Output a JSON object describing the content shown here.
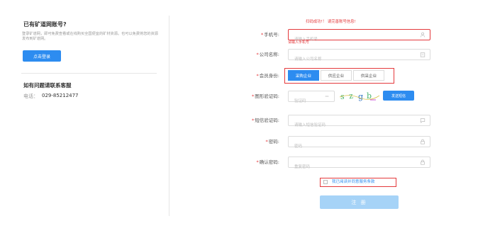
{
  "left": {
    "title": "已有矿道网账号?",
    "description": "登录矿道网，即可免费查看或在线购买全国便宜的矿材资源。也可以免费将您的资源发布到矿道网。",
    "login_label": "点击登录",
    "contact_title": "如有问题请联系客服",
    "phone_label": "电话：",
    "phone_value": "029-85212477"
  },
  "banner": "扫码成功!！ 请完善账号信息!",
  "form": {
    "phone": {
      "label": "手机号:",
      "placeholder": "请输入手机号",
      "icon": "user-icon",
      "error": "请输入手机号"
    },
    "company": {
      "label": "公司名称:",
      "placeholder": "请输入公司名称",
      "icon": "building-icon"
    },
    "role": {
      "label": "会员身份:",
      "options": [
        "采购企业",
        "供应企业",
        "供采企业"
      ],
      "selected": "采购企业"
    },
    "captcha": {
      "label": "图形验证码:",
      "placeholder": "验证码",
      "code": "s z g b",
      "refresh_label": "发送短信"
    },
    "sms": {
      "label": "短信验证码:",
      "placeholder": "请输入短信验证码",
      "icon": "message-icon"
    },
    "password": {
      "label": "密码:",
      "placeholder": "密码",
      "icon": "lock-icon"
    },
    "confirm": {
      "label": "确认密码:",
      "placeholder": "重复密码",
      "icon": "lock-icon"
    },
    "agree_label": "我已阅读并同意服务条款",
    "submit_label": "注 册"
  },
  "colors": {
    "accent": "#2d8cf0",
    "error": "#e4393c",
    "submit_disabled": "#a6d3f7"
  }
}
